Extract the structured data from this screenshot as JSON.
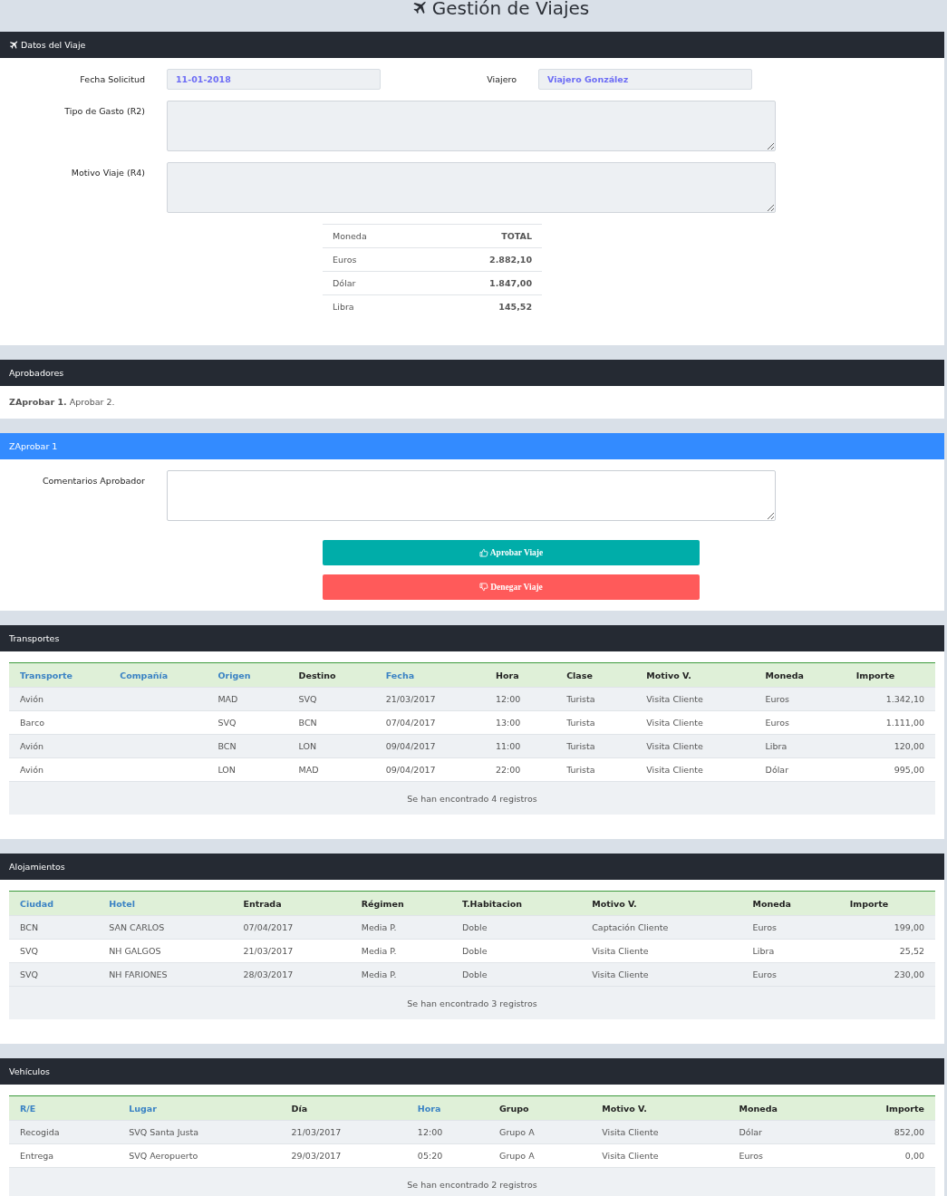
{
  "title": "Gestión de Viajes",
  "sections": [
    {
      "kind": "trip_form",
      "header": "Datos del Viaje",
      "highlighted": false,
      "header_icon": true,
      "inputs": [
        {
          "label": "Fecha Solicitud",
          "value": "11-01-2018",
          "disabled": true
        },
        {
          "label": "Viajero",
          "value": "Viajero González",
          "disabled": true
        }
      ],
      "textareas": [
        {
          "label": "Tipo de Gasto (R2)",
          "disabled": true
        },
        {
          "label": "Motivo Viaje (R4)",
          "disabled": true
        }
      ],
      "totals": {
        "columns": [
          "Moneda",
          "TOTAL"
        ],
        "rows": [
          [
            "Euros",
            "2.882,10"
          ],
          [
            "Dólar",
            "1.847,00"
          ],
          [
            "Libra",
            "145,52"
          ]
        ]
      }
    },
    {
      "kind": "approvers",
      "header": "Aprobadores",
      "highlighted": false,
      "header_icon": false,
      "text": "**ZAprobar 1.** Aprobar 2."
    },
    {
      "kind": "approval",
      "header": "ZAprobar 1",
      "highlighted": true,
      "header_icon": false,
      "comment": {
        "label": "Comentarios Aprobador",
        "disabled": false
      },
      "buttons": [
        {
          "label": "Aprobar Viaje",
          "kind": "approve"
        },
        {
          "label": "Denegar Viaje",
          "kind": "deny"
        }
      ]
    },
    {
      "kind": "table",
      "header": "Transportes",
      "highlighted": false,
      "header_icon": false,
      "columns": [
        {
          "label": "Transporte",
          "sortable": true
        },
        {
          "label": "Compañía",
          "sortable": true
        },
        {
          "label": "Origen",
          "sortable": true
        },
        {
          "label": "Destino",
          "sortable": false
        },
        {
          "label": "Fecha",
          "sortable": true
        },
        {
          "label": "Hora",
          "sortable": false
        },
        {
          "label": "Clase",
          "sortable": false
        },
        {
          "label": "Motivo V.",
          "sortable": false
        },
        {
          "label": "Moneda",
          "sortable": false
        },
        {
          "label": "Importe",
          "sortable": false
        }
      ],
      "rows": [
        [
          "Avión",
          "",
          "MAD",
          "SVQ",
          "21/03/2017",
          "12:00",
          "Turista",
          "Visita Cliente",
          "Euros",
          "1.342,10"
        ],
        [
          "Barco",
          "",
          "SVQ",
          "BCN",
          "07/04/2017",
          "13:00",
          "Turista",
          "Visita Cliente",
          "Euros",
          "1.111,00"
        ],
        [
          "Avión",
          "",
          "BCN",
          "LON",
          "09/04/2017",
          "11:00",
          "Turista",
          "Visita Cliente",
          "Libra",
          "120,00"
        ],
        [
          "Avión",
          "",
          "LON",
          "MAD",
          "09/04/2017",
          "22:00",
          "Turista",
          "Visita Cliente",
          "Dólar",
          "995,00"
        ]
      ],
      "footer": "Se han encontrado 4 registros"
    },
    {
      "kind": "table",
      "header": "Alojamientos",
      "highlighted": false,
      "header_icon": false,
      "columns": [
        {
          "label": "Ciudad",
          "sortable": true
        },
        {
          "label": "Hotel",
          "sortable": true
        },
        {
          "label": "Entrada",
          "sortable": false
        },
        {
          "label": "Régimen",
          "sortable": false
        },
        {
          "label": "T.Habitacion",
          "sortable": false
        },
        {
          "label": "Motivo V.",
          "sortable": false
        },
        {
          "label": "Moneda",
          "sortable": false
        },
        {
          "label": "Importe",
          "sortable": false
        }
      ],
      "rows": [
        [
          "BCN",
          "SAN CARLOS",
          "07/04/2017",
          "Media P.",
          "Doble",
          "Captación Cliente",
          "Euros",
          "199,00"
        ],
        [
          "SVQ",
          "NH GALGOS",
          "21/03/2017",
          "Media P.",
          "Doble",
          "Visita Cliente",
          "Libra",
          "25,52"
        ],
        [
          "SVQ",
          "NH FARIONES",
          "28/03/2017",
          "Media P.",
          "Doble",
          "Visita Cliente",
          "Euros",
          "230,00"
        ]
      ],
      "footer": "Se han encontrado 3 registros"
    },
    {
      "kind": "table",
      "header": "Vehículos",
      "highlighted": false,
      "header_icon": false,
      "columns": [
        {
          "label": "R/E",
          "sortable": true
        },
        {
          "label": "Lugar",
          "sortable": true
        },
        {
          "label": "Día",
          "sortable": false
        },
        {
          "label": "Hora",
          "sortable": true
        },
        {
          "label": "Grupo",
          "sortable": false
        },
        {
          "label": "Motivo V.",
          "sortable": false
        },
        {
          "label": "Moneda",
          "sortable": false
        },
        {
          "label": "Importe",
          "sortable": false
        }
      ],
      "rows": [
        [
          "Recogida",
          "SVQ Santa Justa",
          "21/03/2017",
          "12:00",
          "Grupo A",
          "Visita Cliente",
          "Dólar",
          "852,00"
        ],
        [
          "Entrega",
          "SVQ Aeropuerto",
          "29/03/2017",
          "05:20",
          "Grupo A",
          "Visita Cliente",
          "Euros",
          "0,00"
        ]
      ],
      "footer": "Se han encontrado 2 registros"
    }
  ]
}
